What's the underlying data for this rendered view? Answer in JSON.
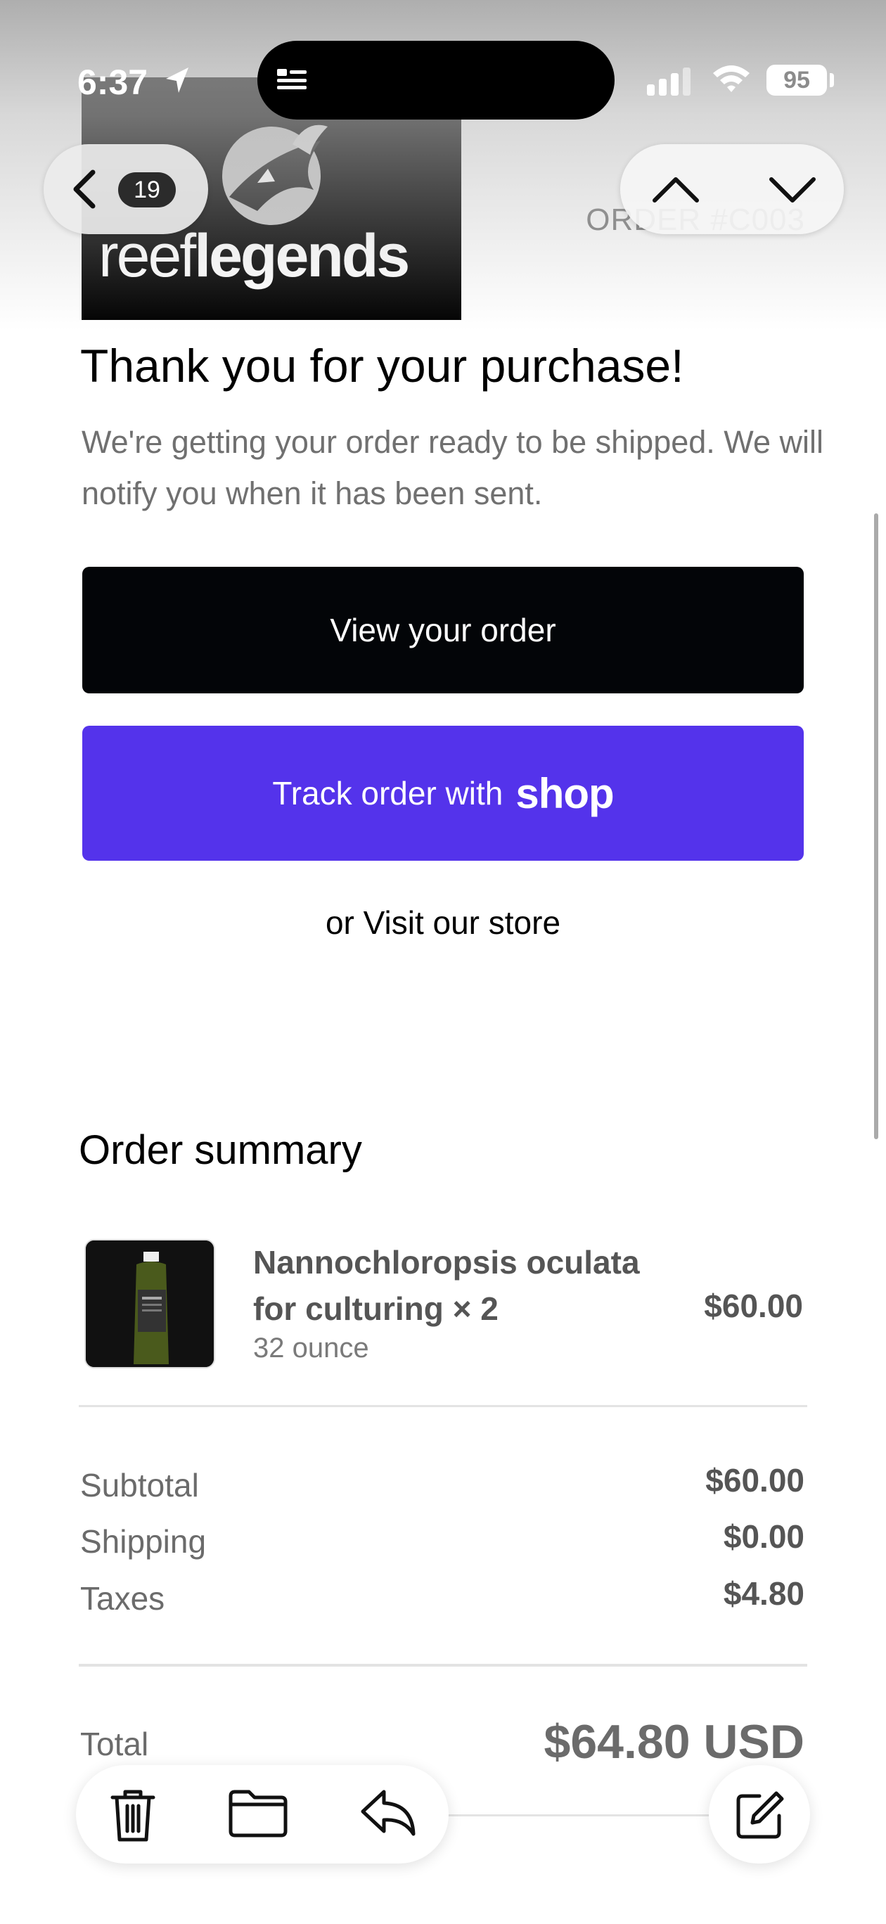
{
  "status_bar": {
    "time": "6:37",
    "battery": "95"
  },
  "nav": {
    "unread_count": "19"
  },
  "brand": {
    "name_light": "reef",
    "name_bold": "legends"
  },
  "order": {
    "number": "ORDER #C003"
  },
  "confirmation": {
    "headline": "Thank you for your purchase!",
    "message": "We're getting your order ready to be shipped. We will notify you when it has been sent."
  },
  "actions": {
    "view_order": "View your order",
    "track_prefix": "Track order with",
    "track_brand": "shop",
    "visit_store": "or Visit our store"
  },
  "summary": {
    "title": "Order summary",
    "item": {
      "name": "Nannochloropsis oculata for culturing × 2",
      "variant": "32 ounce",
      "price": "$60.00"
    },
    "subtotal_label": "Subtotal",
    "subtotal_value": "$60.00",
    "shipping_label": "Shipping",
    "shipping_value": "$0.00",
    "taxes_label": "Taxes",
    "taxes_value": "$4.80",
    "total_label": "Total",
    "total_value": "$64.80 USD"
  },
  "colors": {
    "shop_purple": "#5433EB",
    "primary_button": "#030508"
  },
  "icons": [
    "location-arrow-icon",
    "live-activity-icon",
    "signal-icon",
    "wifi-icon",
    "battery-icon",
    "chevron-left-icon",
    "chevron-up-icon",
    "chevron-down-icon",
    "trash-icon",
    "folder-icon",
    "reply-icon",
    "compose-icon"
  ]
}
